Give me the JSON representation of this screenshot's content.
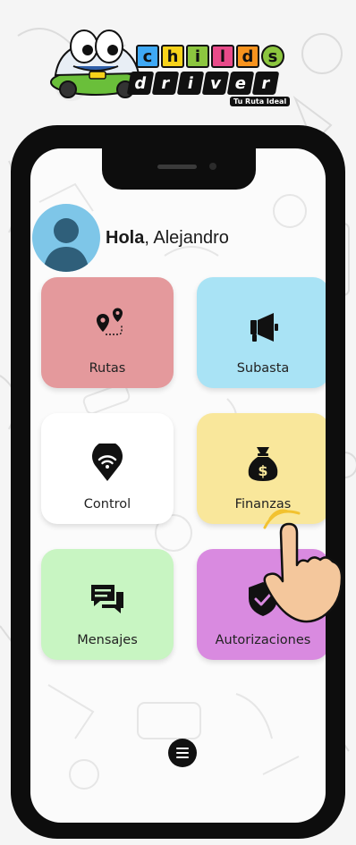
{
  "logo": {
    "word_top": [
      "c",
      "h",
      "i",
      "l",
      "d",
      "s"
    ],
    "word_bottom": [
      "d",
      "r",
      "i",
      "v",
      "e",
      "r"
    ],
    "tagline": "Tu Ruta Ideal",
    "tile_colors": [
      "#3fa9f5",
      "#f7d21a",
      "#8cc63f",
      "#e94b8a",
      "#f7931e",
      "#8cc63f"
    ]
  },
  "greeting": {
    "hello": "Hola",
    "name": ", Alejandro"
  },
  "tiles": [
    {
      "label": "Rutas",
      "color": "#e4999c",
      "icon": "route-pins-icon"
    },
    {
      "label": "Subasta",
      "color": "#a9e3f5",
      "icon": "megaphone-icon"
    },
    {
      "label": "Control",
      "color": "#ffffff",
      "icon": "wifi-location-icon"
    },
    {
      "label": "Finanzas",
      "color": "#f9e79b",
      "icon": "money-bag-icon"
    },
    {
      "label": "Mensajes",
      "color": "#c8f5c2",
      "icon": "chat-bubbles-icon"
    },
    {
      "label": "Autorizaciones",
      "color": "#d98ae0",
      "icon": "shield-check-icon"
    }
  ],
  "menu": {
    "icon": "menu-icon"
  }
}
